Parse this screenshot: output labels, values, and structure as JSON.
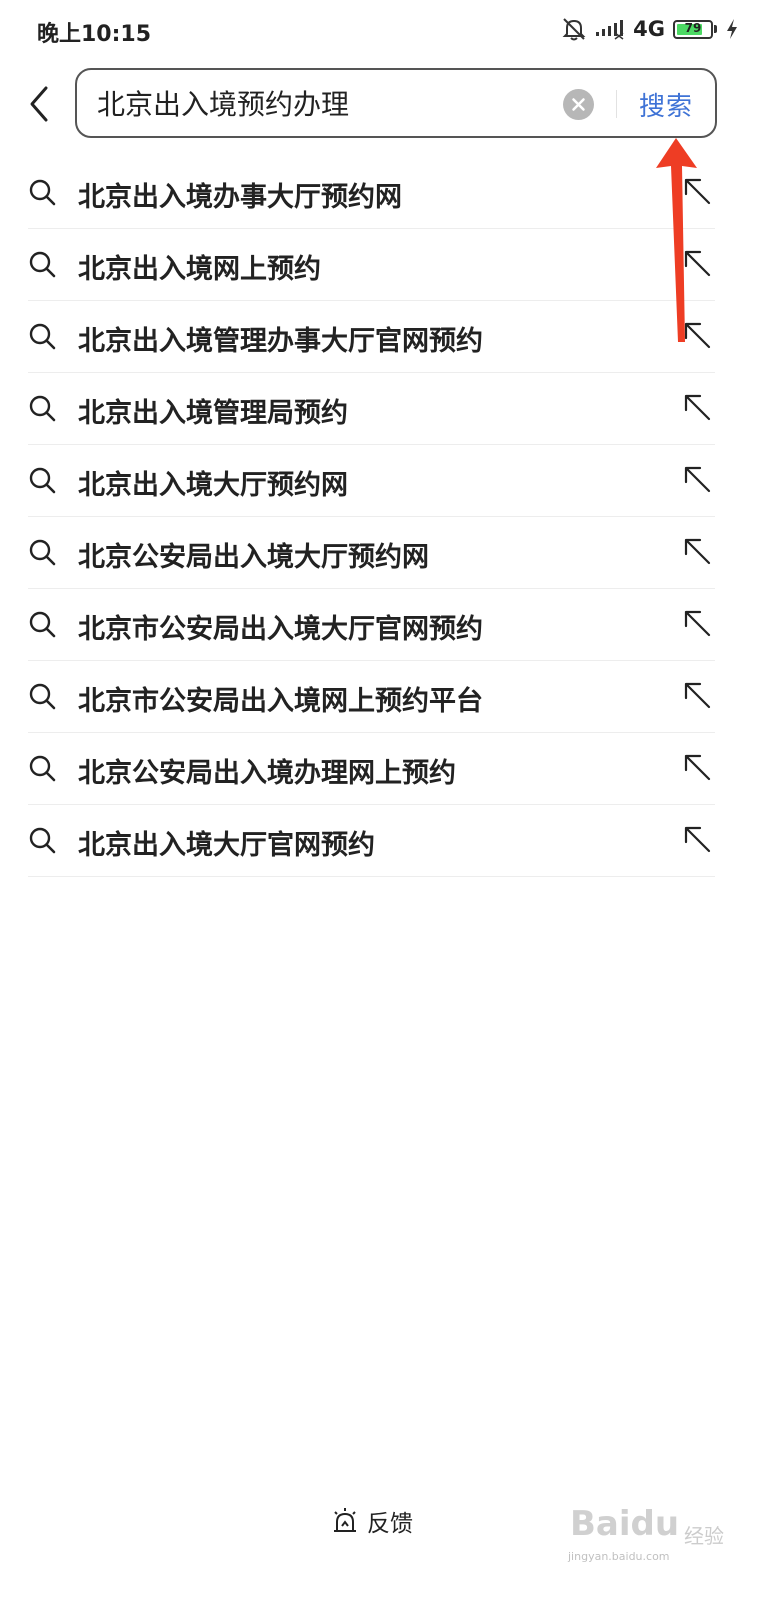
{
  "status_bar": {
    "time": "晚上10:15",
    "network": "4G",
    "battery_level": "79",
    "icons": [
      "mute-bell-icon",
      "signal-icon",
      "battery-icon",
      "charging-icon"
    ]
  },
  "search": {
    "query": "北京出入境预约办理",
    "button_label": "搜索",
    "accent_color": "#3f73d6"
  },
  "suggestions": [
    {
      "text": "北京出入境办事大厅预约网"
    },
    {
      "text": "北京出入境网上预约"
    },
    {
      "text": "北京出入境管理办事大厅官网预约"
    },
    {
      "text": "北京出入境管理局预约"
    },
    {
      "text": "北京出入境大厅预约网"
    },
    {
      "text": "北京公安局出入境大厅预约网"
    },
    {
      "text": "北京市公安局出入境大厅官网预约"
    },
    {
      "text": "北京市公安局出入境网上预约平台"
    },
    {
      "text": "北京公安局出入境办理网上预约"
    },
    {
      "text": "北京出入境大厅官网预约"
    }
  ],
  "annotation": {
    "color": "#ee3d24"
  },
  "footer": {
    "feedback_label": "反馈"
  },
  "watermark": {
    "brand": "Baidu",
    "cn": "经验",
    "url": "jingyan.baidu.com"
  }
}
